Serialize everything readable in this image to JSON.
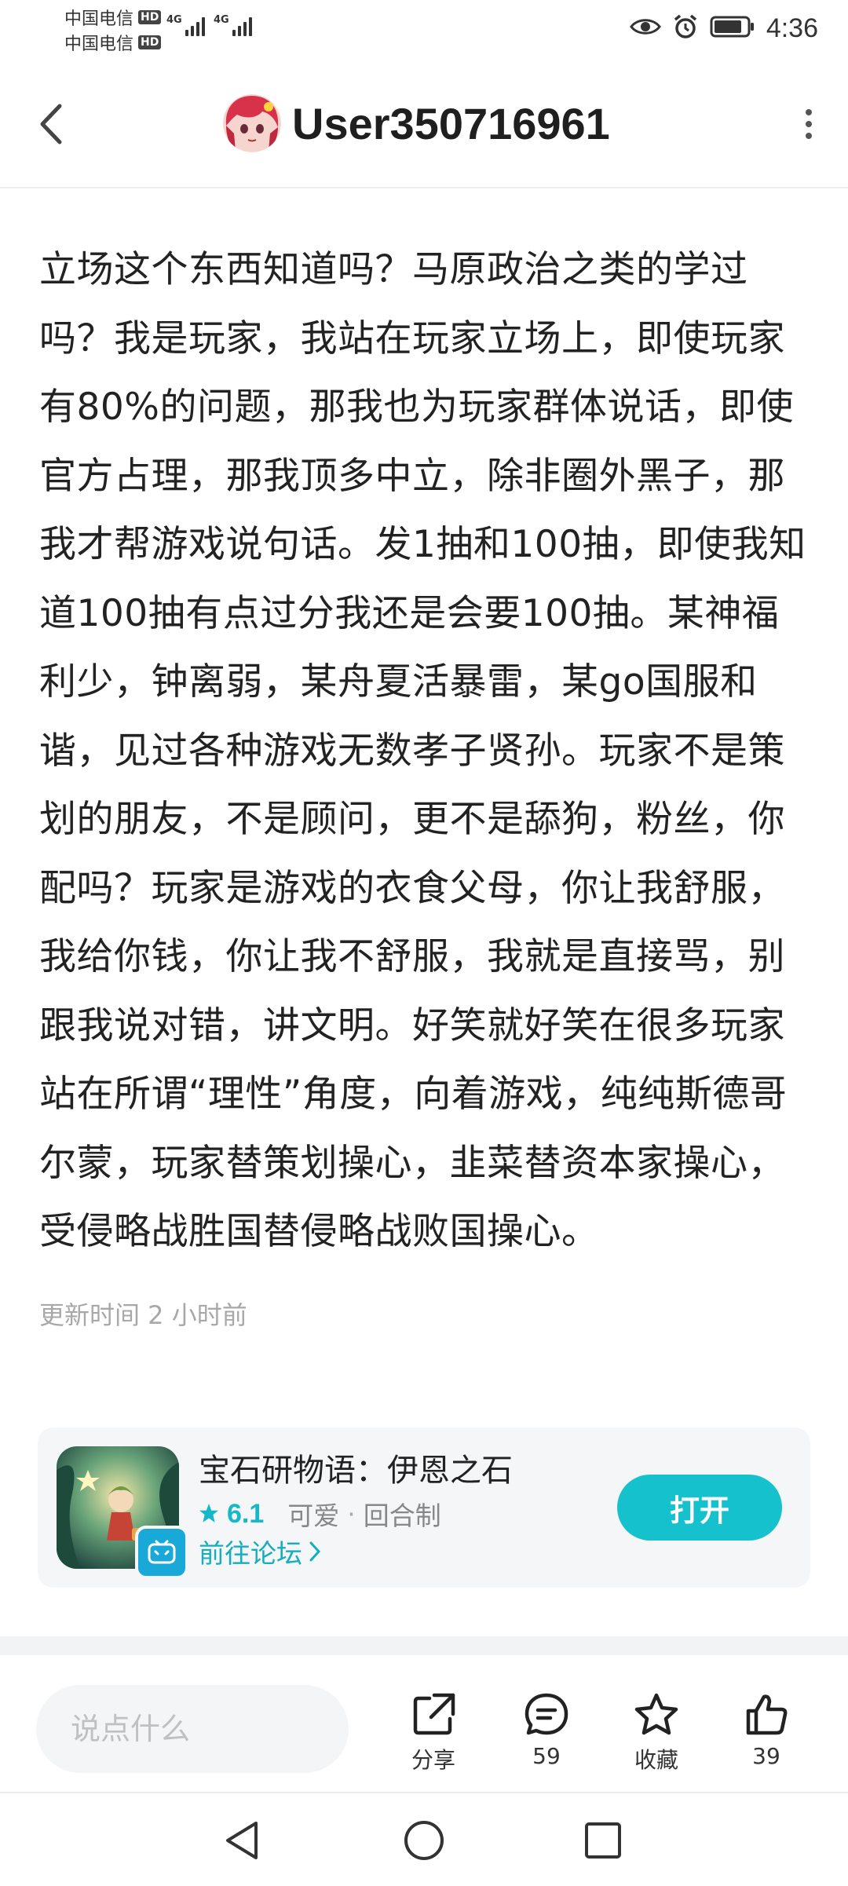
{
  "status_bar": {
    "carrier1": "中国电信",
    "carrier2": "中国电信",
    "hd": "HD",
    "net1": "4G",
    "net2": "4G",
    "time": "4:36"
  },
  "header": {
    "username": "User350716961"
  },
  "post": {
    "content": "立场这个东西知道吗？马原政治之类的学过吗？我是玩家，我站在玩家立场上，即使玩家有80%的问题，那我也为玩家群体说话，即使官方占理，那我顶多中立，除非圈外黑子，那我才帮游戏说句话。发1抽和100抽，即使我知道100抽有点过分我还是会要100抽。某神福利少，钟离弱，某舟夏活暴雷，某go国服和谐，见过各种游戏无数孝子贤孙。玩家不是策划的朋友，不是顾问，更不是舔狗，粉丝，你配吗？玩家是游戏的衣食父母，你让我舒服，我给你钱，你让我不舒服，我就是直接骂，别跟我说对错，讲文明。好笑就好笑在很多玩家站在所谓“理性”角度，向着游戏，纯纯斯德哥尔蒙，玩家替策划操心，韭菜替资本家操心，受侵略战胜国替侵略战败国操心。",
    "update_time": "更新时间 2 小时前"
  },
  "game_card": {
    "title": "宝石研物语：伊恩之石",
    "rating": "6.1",
    "tag1": "可爱",
    "separator": "·",
    "tag2": "回合制",
    "forum_link": "前往论坛",
    "open_label": "打开"
  },
  "action_bar": {
    "comment_placeholder": "说点什么",
    "share_label": "分享",
    "comment_count": "59",
    "favorite_label": "收藏",
    "like_count": "39"
  },
  "colors": {
    "accent": "#15c1cd",
    "link": "#14aebf",
    "muted": "#a8a8a8"
  }
}
